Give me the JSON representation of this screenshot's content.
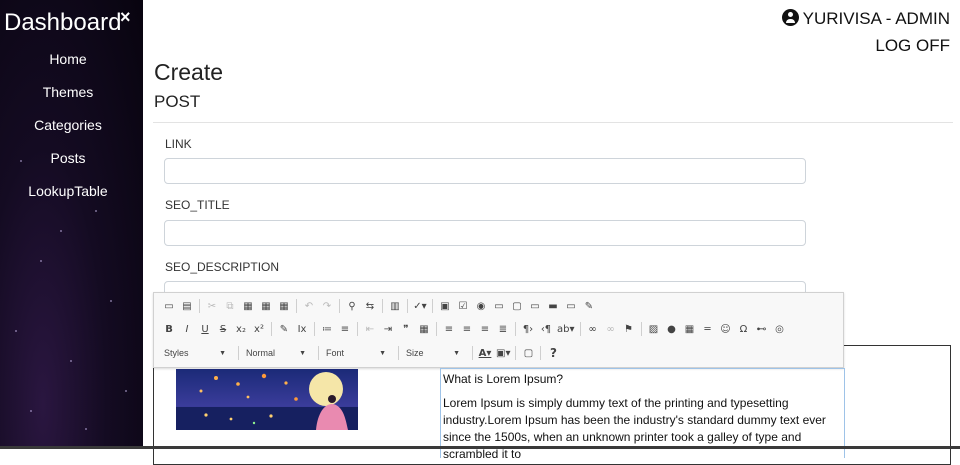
{
  "sidebar": {
    "brand": "Dashboard",
    "close_symbol": "×",
    "items": [
      {
        "label": "Home"
      },
      {
        "label": "Themes"
      },
      {
        "label": "Categories"
      },
      {
        "label": "Posts"
      },
      {
        "label": "LookupTable"
      }
    ]
  },
  "header": {
    "user_name": "YURIVISA - ADMIN",
    "logoff": "LOG OFF"
  },
  "page": {
    "title": "Create",
    "subtitle": "POST"
  },
  "form": {
    "link_label": "LINK",
    "link_value": "",
    "seo_title_label": "SEO_TITLE",
    "seo_title_value": "",
    "seo_description_label": "SEO_DESCRIPTION",
    "seo_description_value": ""
  },
  "toolbar": {
    "styles": "Styles",
    "format": "Normal",
    "font": "Font",
    "size": "Size",
    "help": "?"
  },
  "editor": {
    "heading": "What is Lorem Ipsum?",
    "paragraph": "Lorem Ipsum is simply dummy text of the printing and typesetting industry.Lorem Ipsum has been the industry's standard dummy text ever since the 1500s, when an unknown printer took a galley of type and scrambled it to"
  }
}
